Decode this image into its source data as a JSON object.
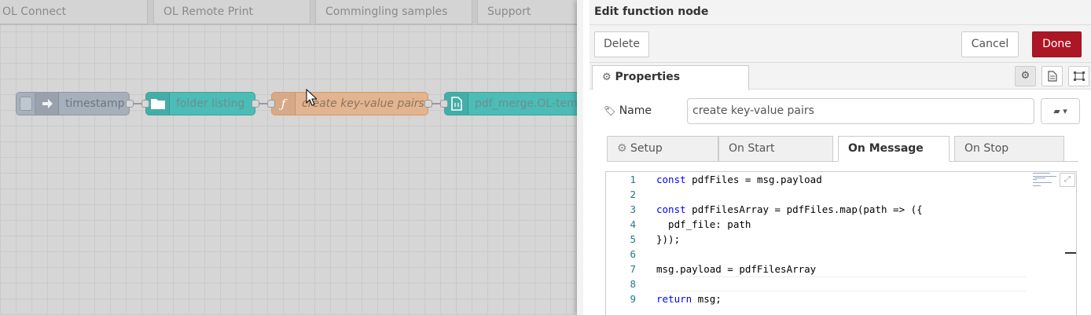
{
  "workspace": {
    "tabs": [
      "OL Connect",
      "OL Remote Print",
      "Commingling samples",
      "Support"
    ],
    "nodes": [
      {
        "label": "timestamp",
        "icon": "arrow-right-icon"
      },
      {
        "label": "folder listing",
        "icon": "folder-icon"
      },
      {
        "label": "create key-value pairs",
        "icon": "function-icon",
        "icon_glyph": "ƒ"
      },
      {
        "label": "pdf_merge.OL-templa",
        "icon": "file-js-icon"
      }
    ]
  },
  "editor": {
    "title": "Edit function node",
    "delete_label": "Delete",
    "cancel_label": "Cancel",
    "done_label": "Done",
    "properties_tab": "Properties",
    "name_label": "Name",
    "name_value": "create key-value pairs",
    "sub_tabs": [
      "Setup",
      "On Start",
      "On Message",
      "On Stop"
    ],
    "active_sub_tab": "On Message",
    "colors": {
      "done": "#ad1625",
      "keyword": "#0000ff",
      "line_number": "#237893"
    }
  },
  "code": {
    "line_numbers": [
      "1",
      "2",
      "3",
      "4",
      "5",
      "6",
      "7",
      "8",
      "9"
    ],
    "lines": [
      {
        "kw": "const",
        "text": " pdfFiles = msg.payload"
      },
      {
        "kw": "",
        "text": ""
      },
      {
        "kw": "const",
        "text": " pdfFilesArray = pdfFiles.map(path => ({"
      },
      {
        "kw": "",
        "text": "  pdf_file: path"
      },
      {
        "kw": "",
        "text": "}));"
      },
      {
        "kw": "",
        "text": ""
      },
      {
        "kw": "",
        "text": "msg.payload = pdfFilesArray"
      },
      {
        "kw": "",
        "text": ""
      },
      {
        "kw": "return",
        "text": " msg;"
      }
    ]
  }
}
